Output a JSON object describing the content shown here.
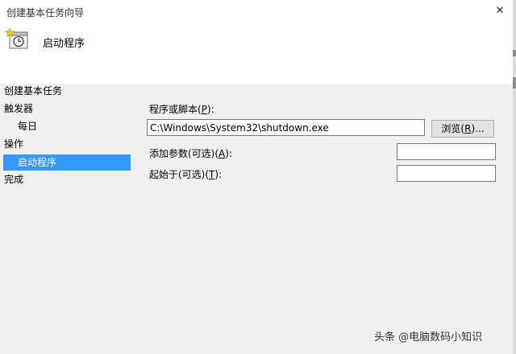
{
  "window": {
    "title": "创建基本任务向导",
    "close_glyph": "✕"
  },
  "header": {
    "title": "启动程序",
    "icon": "task-scheduler-icon"
  },
  "nav": {
    "section_title": "创建基本任务",
    "items": [
      {
        "label": "触发器",
        "level": 0
      },
      {
        "label": "每日",
        "level": 1
      },
      {
        "label": "操作",
        "level": 0
      },
      {
        "label": "启动程序",
        "level": 1,
        "selected": true
      },
      {
        "label": "完成",
        "level": 0
      }
    ]
  },
  "form": {
    "program_label_prefix": "程序或脚本(",
    "program_label_key": "P",
    "program_label_suffix": "):",
    "program_value": "C:\\Windows\\System32\\shutdown.exe",
    "browse_prefix": "浏览(",
    "browse_key": "R",
    "browse_suffix": ")...",
    "args_label_prefix": "添加参数(可选)(",
    "args_label_key": "A",
    "args_label_suffix": "):",
    "args_value": "",
    "start_label_prefix": "起始于(可选)(",
    "start_label_key": "T",
    "start_label_suffix": "):",
    "start_value": ""
  },
  "watermark": "头条 @电脑数码小知识",
  "colors": {
    "selection": "#3399ff",
    "header_bg": "#ffffff",
    "window_bg": "#f0f0f0"
  }
}
